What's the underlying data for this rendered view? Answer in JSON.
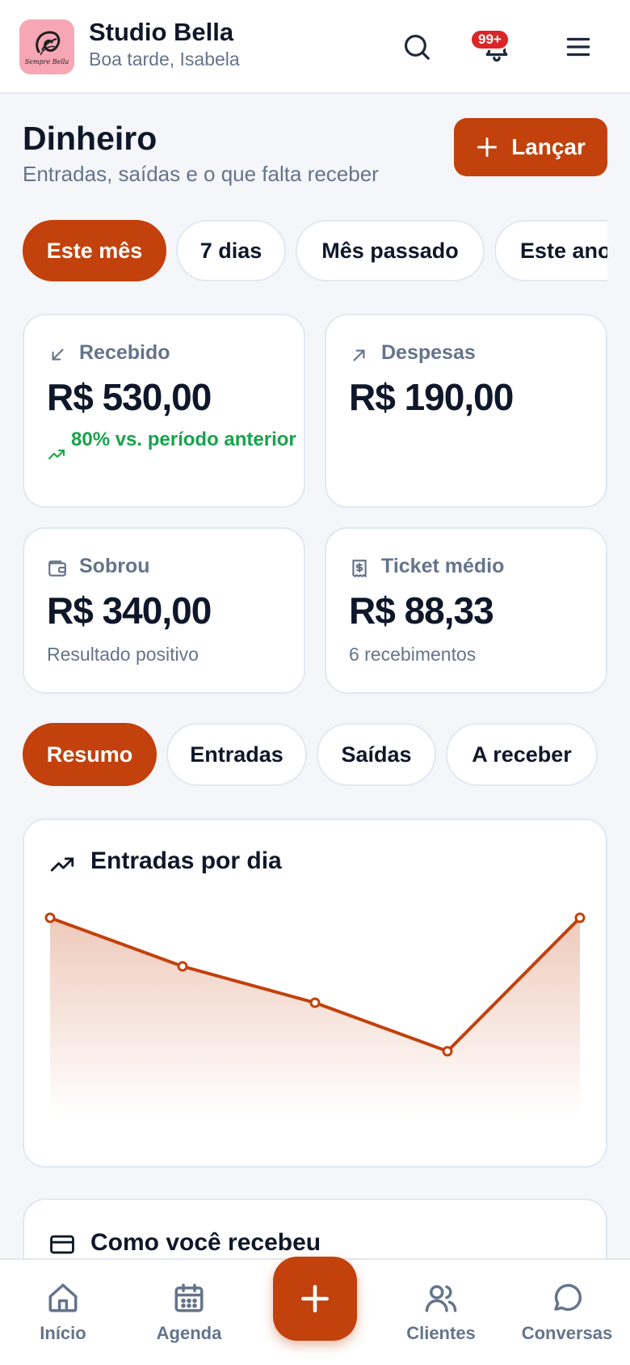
{
  "colors": {
    "accent": "#c2410c",
    "positive": "#16a34a",
    "badge": "#dc2626",
    "muted": "#64748b",
    "text": "#0f172a"
  },
  "header": {
    "logo_text": "Sempre Bella",
    "title": "Studio Bella",
    "greeting": "Boa tarde, Isabela",
    "notifications_badge": "99+",
    "icons": [
      "search-icon",
      "bell-icon",
      "menu-icon"
    ]
  },
  "page": {
    "title": "Dinheiro",
    "subtitle": "Entradas, saídas e o que falta receber",
    "primary_action": "Lançar"
  },
  "periods": {
    "selected": "Este mês",
    "options": [
      "Este mês",
      "7 dias",
      "Mês passado",
      "Este ano"
    ]
  },
  "stats": {
    "received": {
      "label": "Recebido",
      "value": "R$ 530,00",
      "trend": "80% vs. período anterior",
      "icon": "arrow-down-left-icon"
    },
    "expenses": {
      "label": "Despesas",
      "value": "R$ 190,00",
      "icon": "arrow-up-right-icon"
    },
    "left": {
      "label": "Sobrou",
      "value": "R$ 340,00",
      "note": "Resultado positivo",
      "icon": "wallet-icon"
    },
    "ticket": {
      "label": "Ticket médio",
      "value": "R$ 88,33",
      "note": "6 recebimentos",
      "icon": "receipt-icon"
    }
  },
  "tabs": {
    "selected": "Resumo",
    "items": [
      "Resumo",
      "Entradas",
      "Saídas",
      "A receber"
    ]
  },
  "chart_data": {
    "type": "area",
    "title": "Entradas por dia",
    "xlabel": "",
    "ylabel": "",
    "x": [
      1,
      2,
      3,
      4,
      5
    ],
    "values": [
      150,
      110,
      80,
      40,
      150
    ],
    "ylim": [
      0,
      160
    ],
    "grid": false,
    "color": "#c2410c"
  },
  "payment_section": {
    "title": "Como você recebeu",
    "icon": "credit-card-icon"
  },
  "bottom_nav": {
    "items": [
      {
        "label": "Início",
        "icon": "home-icon"
      },
      {
        "label": "Agenda",
        "icon": "calendar-icon"
      },
      {
        "label": "Clientes",
        "icon": "users-icon"
      },
      {
        "label": "Conversas",
        "icon": "chat-icon"
      }
    ],
    "fab_icon": "plus-icon"
  }
}
